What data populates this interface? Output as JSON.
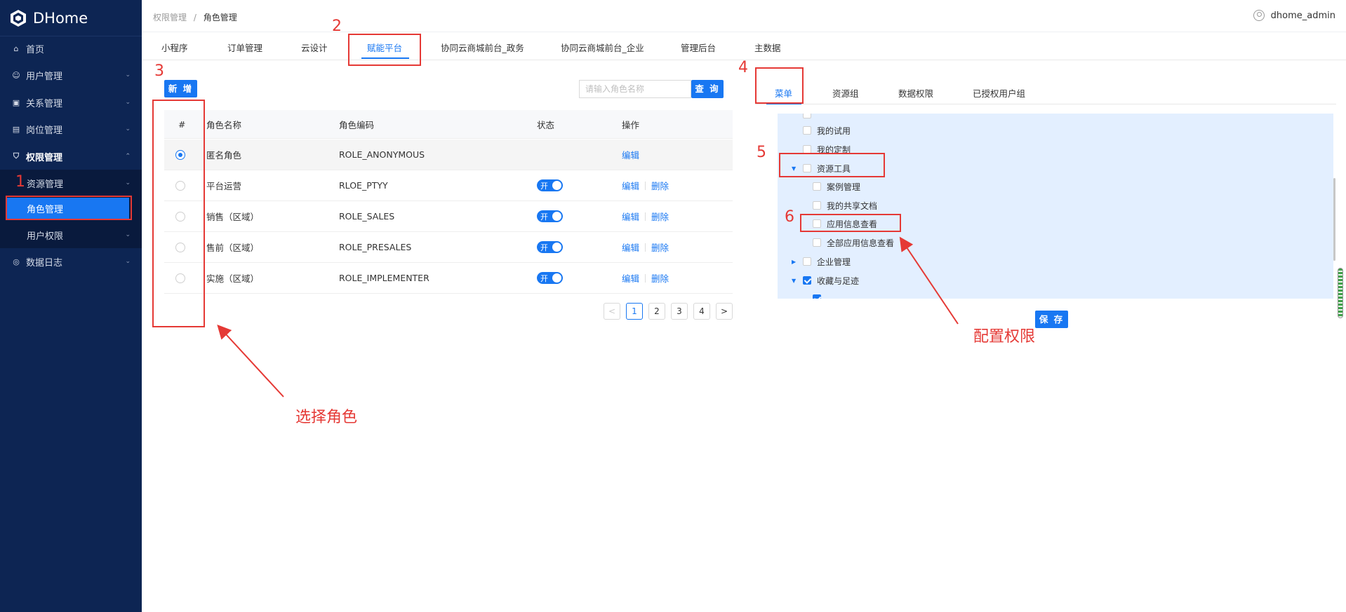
{
  "app": {
    "name": "DHome"
  },
  "sidebar": {
    "items": [
      {
        "label": "首页",
        "icon": "home-icon"
      },
      {
        "label": "用户管理",
        "icon": "user-icon"
      },
      {
        "label": "关系管理",
        "icon": "relation-icon"
      },
      {
        "label": "岗位管理",
        "icon": "badge-icon"
      },
      {
        "label": "权限管理",
        "icon": "shield-icon"
      },
      {
        "label": "资源管理"
      },
      {
        "label": "角色管理"
      },
      {
        "label": "用户权限"
      },
      {
        "label": "数据日志",
        "icon": "log-icon"
      }
    ]
  },
  "header": {
    "breadcrumb": [
      "权限管理",
      "角色管理"
    ],
    "breadcrumb_sep": "/",
    "username": "dhome_admin"
  },
  "tabs": [
    "小程序",
    "订单管理",
    "云设计",
    "赋能平台",
    "协同云商城前台_政务",
    "协同云商城前台_企业",
    "管理后台",
    "主数据"
  ],
  "active_tab": "赋能平台",
  "left": {
    "add_button": "新 增",
    "search": {
      "placeholder": "请输入角色名称",
      "value": "",
      "button": "查 询"
    },
    "table": {
      "headers": [
        "#",
        "角色名称",
        "角色编码",
        "状态",
        "操作"
      ],
      "rows": [
        {
          "name": "匿名角色",
          "code": "ROLE_ANONYMOUS",
          "status": "",
          "actions": [
            "编辑"
          ],
          "selected": true
        },
        {
          "name": "平台运营",
          "code": "RLOE_PTYY",
          "status": "开",
          "actions": [
            "编辑",
            "删除"
          ],
          "selected": false
        },
        {
          "name": "销售（区域）",
          "code": "ROLE_SALES",
          "status": "开",
          "actions": [
            "编辑",
            "删除"
          ],
          "selected": false
        },
        {
          "name": "售前（区域）",
          "code": "ROLE_PRESALES",
          "status": "开",
          "actions": [
            "编辑",
            "删除"
          ],
          "selected": false
        },
        {
          "name": "实施（区域）",
          "code": "ROLE_IMPLEMENTER",
          "status": "开",
          "actions": [
            "编辑",
            "删除"
          ],
          "selected": false
        }
      ]
    },
    "pagination": {
      "prev": "<",
      "pages": [
        "1",
        "2",
        "3",
        "4"
      ],
      "current": "1",
      "next": ">"
    }
  },
  "right": {
    "tabs": [
      "菜单",
      "资源组",
      "数据权限",
      "已授权用户组"
    ],
    "active_tab": "菜单",
    "tree": [
      {
        "label": "我的试用",
        "checked": false,
        "caret": ""
      },
      {
        "label": "我的定制",
        "checked": false,
        "caret": ""
      },
      {
        "label": "资源工具",
        "checked": false,
        "caret": "▼"
      },
      {
        "label": "案例管理",
        "checked": false,
        "caret": ""
      },
      {
        "label": "我的共享文档",
        "checked": false,
        "caret": ""
      },
      {
        "label": "应用信息查看",
        "checked": false,
        "caret": ""
      },
      {
        "label": "全部应用信息查看",
        "checked": false,
        "caret": ""
      },
      {
        "label": "企业管理",
        "checked": false,
        "caret": "▶"
      },
      {
        "label": "收藏与足迹",
        "checked": true,
        "caret": "▼"
      }
    ],
    "save_button": "保 存"
  },
  "annotations": {
    "numbers": [
      "1",
      "2",
      "3",
      "4",
      "5",
      "6"
    ],
    "select_role": "选择角色",
    "configure_permissions": "配置权限",
    "color": "#e53935"
  },
  "colors": {
    "primary": "#1877f2",
    "sidebar_bg": "#0d2553",
    "tree_bg": "#e3efff"
  }
}
